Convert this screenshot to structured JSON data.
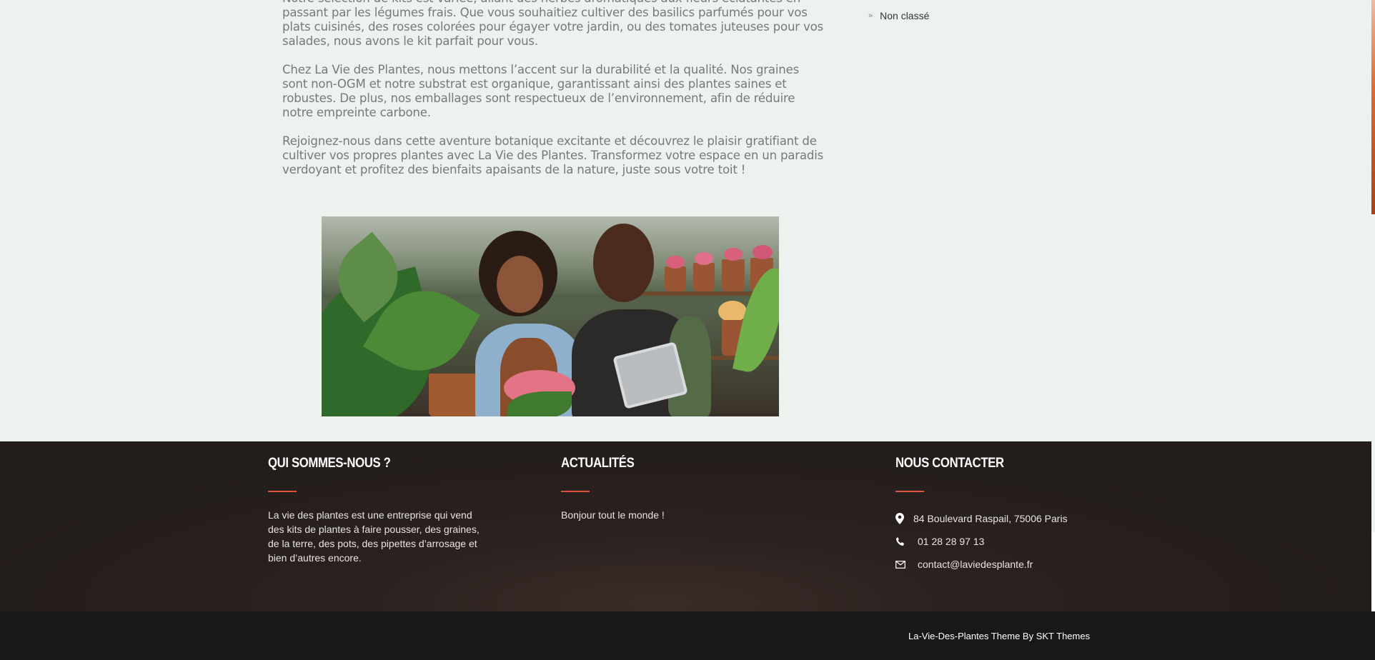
{
  "article": {
    "paragraphs": [
      "Notre sélection de kits est variée, allant des herbes aromatiques aux fleurs éclatantes en passant par les légumes frais. Que vous souhaitiez cultiver des basilics parfumés pour vos plats cuisinés, des roses colorées pour égayer votre jardin, ou des tomates juteuses pour vos salades, nous avons le kit parfait pour vous.",
      "Chez La Vie des Plantes, nous mettons l’accent sur la durabilité et la qualité. Nos graines sont non-OGM et notre substrat est organique, garantissant ainsi des plantes saines et robustes. De plus, nos emballages sont respectueux de l’environnement, afin de réduire notre empreinte carbone.",
      "Rejoignez-nous dans cette aventure botanique excitante et découvrez le plaisir gratifiant de cultiver vos propres plantes avec La Vie des Plantes. Transformez votre espace en un paradis verdoyant et profitez des bienfaits apaisants de la nature, juste sous votre toit !"
    ]
  },
  "sidebar": {
    "categories": [
      {
        "label": "Non classé",
        "icon": "chevron-right-icon"
      }
    ]
  },
  "footer": {
    "about": {
      "heading": "QUI SOMMES-NOUS ?",
      "text": "La vie des plantes est une entreprise qui vend des kits de plantes à faire pousser, des graines, de la terre, des pots, des pipettes d’arrosage et bien d’autres encore."
    },
    "news": {
      "heading": "ACTUALITÉS",
      "items": [
        "Bonjour tout le monde !"
      ]
    },
    "contact": {
      "heading": "NOUS CONTACTER",
      "address": "84 Boulevard Raspail, 75006 Paris",
      "phone": "01 28 28 97 13",
      "email": "contact@laviedesplante.fr"
    },
    "copyright": "La-Vie-Des-Plantes Theme By SKT Themes"
  },
  "colors": {
    "page_background": "#eef2ee",
    "accent": "#e0533a",
    "footer_background": "#231d1b",
    "copyright_background": "#181818"
  }
}
